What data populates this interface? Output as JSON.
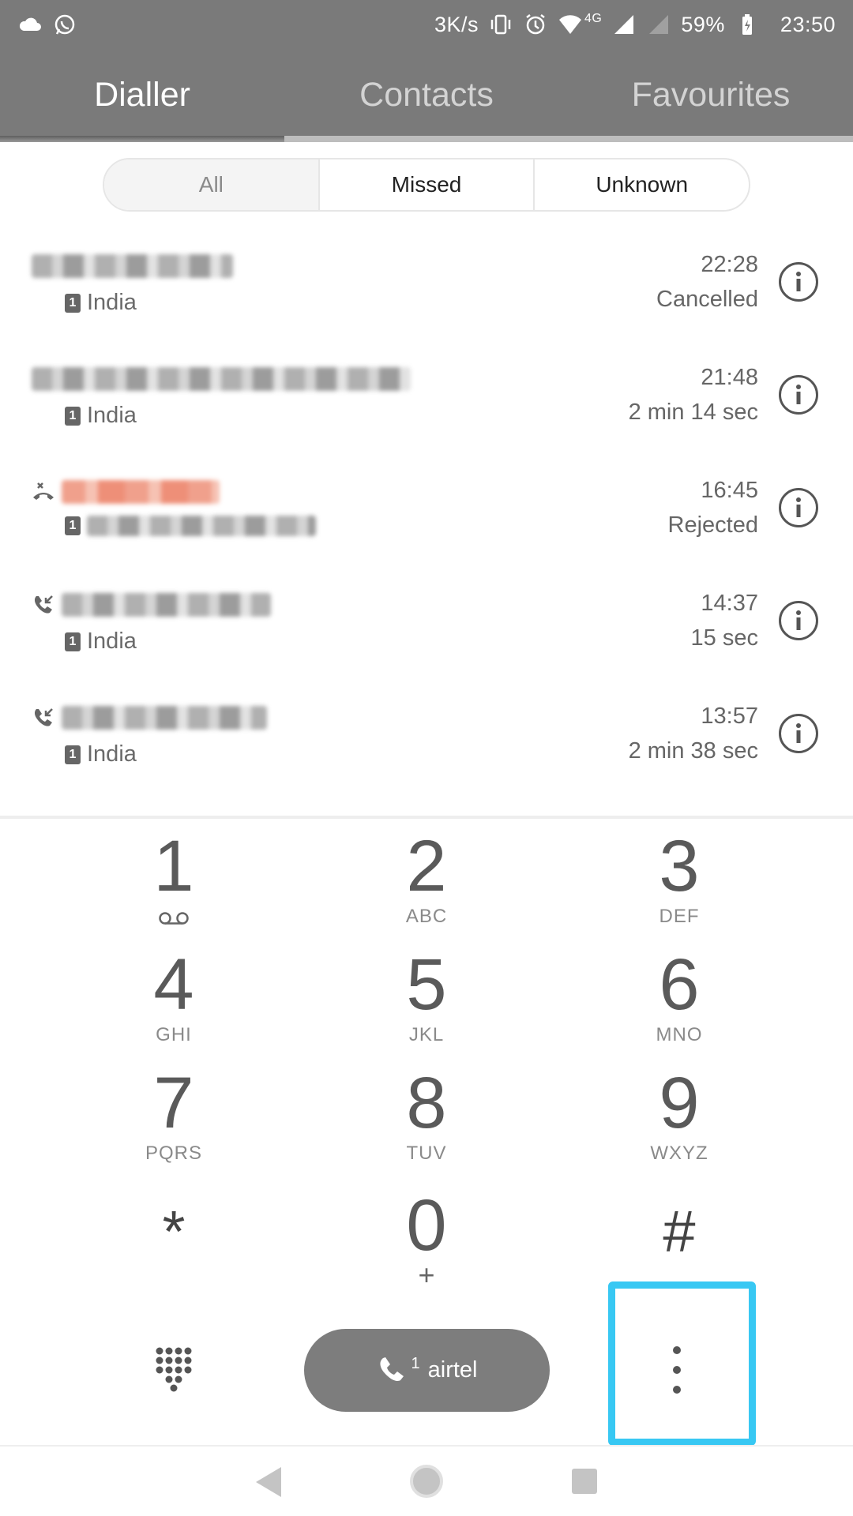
{
  "status_bar": {
    "speed": "3K/s",
    "battery": "59%",
    "time": "23:50",
    "network": "4G",
    "icons": [
      "cloud-icon",
      "whatsapp-icon",
      "vibrate-icon",
      "alarm-icon",
      "wifi-icon",
      "signal-icon",
      "signal-icon",
      "battery-charging-icon"
    ]
  },
  "tabs": [
    {
      "label": "Dialler",
      "active": true
    },
    {
      "label": "Contacts",
      "active": false
    },
    {
      "label": "Favourites",
      "active": false
    }
  ],
  "filter": {
    "options": [
      "All",
      "Missed",
      "Unknown"
    ],
    "selected": "All"
  },
  "calls": [
    {
      "type": "none",
      "location": "India",
      "time": "22:28",
      "detail": "Cancelled",
      "sim": "1",
      "name_redacted": true
    },
    {
      "type": "none",
      "location": "India",
      "time": "21:48",
      "detail": "2 min 14 sec",
      "sim": "1",
      "name_redacted": true
    },
    {
      "type": "rejected",
      "location": "",
      "time": "16:45",
      "detail": "Rejected",
      "sim": "1",
      "name_redacted": true
    },
    {
      "type": "incoming",
      "location": "India",
      "time": "14:37",
      "detail": "15 sec",
      "sim": "1",
      "name_redacted": true
    },
    {
      "type": "incoming",
      "location": "India",
      "time": "13:57",
      "detail": "2 min 38 sec",
      "sim": "1",
      "name_redacted": true
    }
  ],
  "keypad": [
    {
      "digit": "1",
      "letters": ""
    },
    {
      "digit": "2",
      "letters": "ABC"
    },
    {
      "digit": "3",
      "letters": "DEF"
    },
    {
      "digit": "4",
      "letters": "GHI"
    },
    {
      "digit": "5",
      "letters": "JKL"
    },
    {
      "digit": "6",
      "letters": "MNO"
    },
    {
      "digit": "7",
      "letters": "PQRS"
    },
    {
      "digit": "8",
      "letters": "TUV"
    },
    {
      "digit": "9",
      "letters": "WXYZ"
    },
    {
      "digit": "*",
      "letters": ""
    },
    {
      "digit": "0",
      "letters": "+"
    },
    {
      "digit": "#",
      "letters": ""
    }
  ],
  "call_button": {
    "sim": "1",
    "carrier": "airtel"
  },
  "highlight_color": "#38c8f3",
  "accent": "#7a7a7a"
}
